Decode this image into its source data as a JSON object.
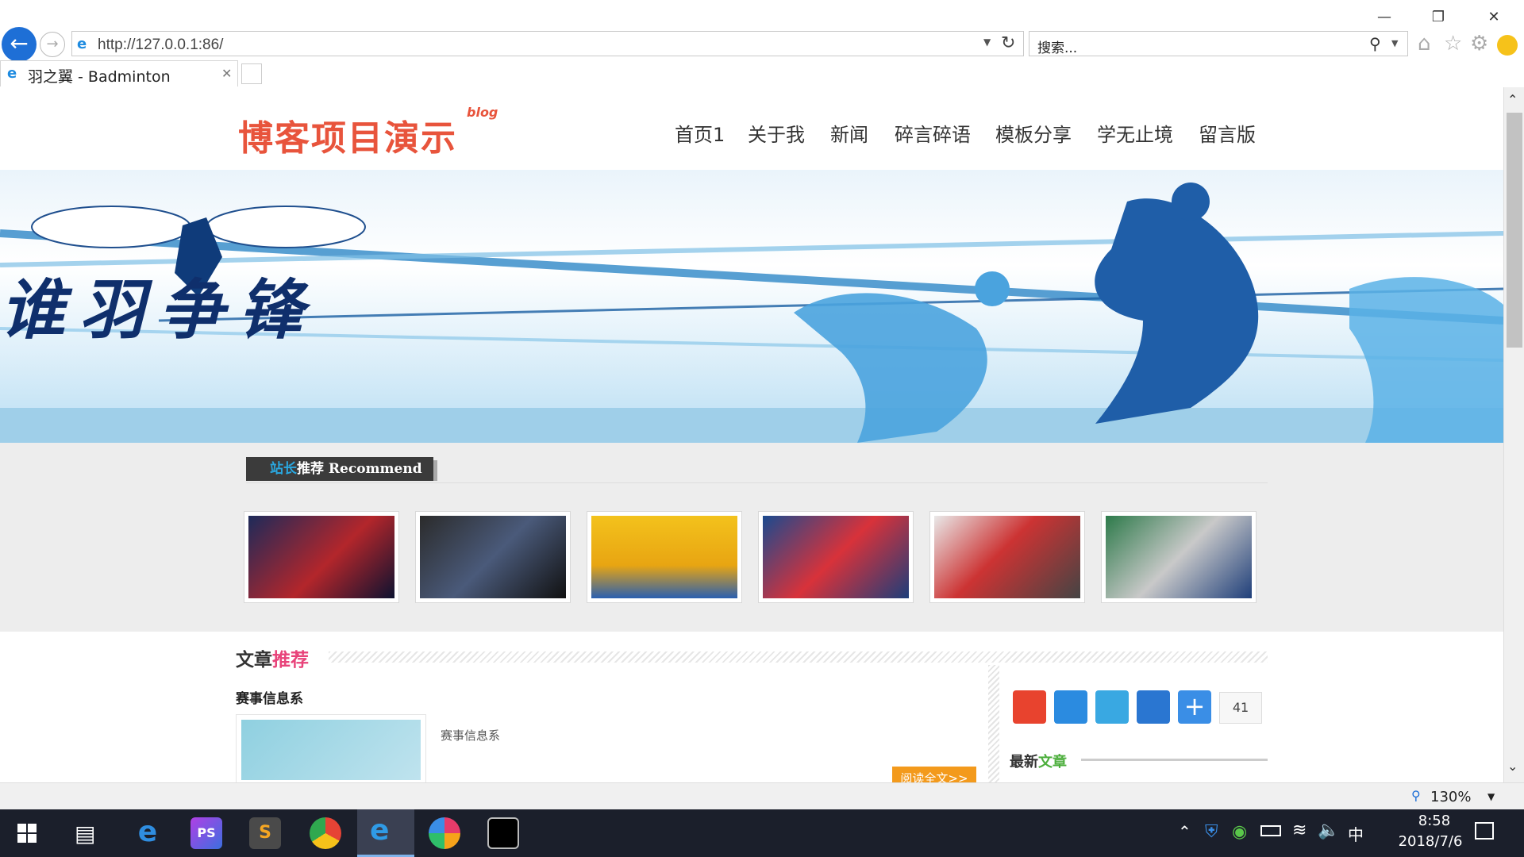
{
  "browser": {
    "address_url": "http://127.0.0.1:86/",
    "search_placeholder": "搜索...",
    "tab_title": "羽之翼 - Badminton",
    "zoom": "130%"
  },
  "site": {
    "logo": "博客项目演示",
    "logo_badge": "blog",
    "nav": [
      "首页1",
      "关于我",
      "新闻",
      "碎言碎语",
      "模板分享",
      "学无止境",
      "留言版"
    ],
    "banner_slogan": "谁羽争锋"
  },
  "recommend": {
    "label_accent": "站长",
    "label_rest": "推荐 Recommend",
    "photos": [
      "photo-1",
      "photo-2",
      "photo-3",
      "photo-4",
      "photo-5",
      "photo-6"
    ]
  },
  "articles": {
    "title_main": "文章",
    "title_accent": "推荐",
    "item_heading": "赛事信息系",
    "item_summary": "赛事信息系",
    "read_more": "阅读全文>>"
  },
  "sidebar": {
    "share_count": "41",
    "latest_main": "最新",
    "latest_accent": "文章"
  },
  "taskbar": {
    "time": "8:58",
    "date": "2018/7/6",
    "ime": "中"
  },
  "colors": {
    "accent_blue": "#2aa7df",
    "accent_pink": "#e8437a",
    "accent_green": "#4cae3c",
    "accent_orange": "#f39a1c"
  }
}
